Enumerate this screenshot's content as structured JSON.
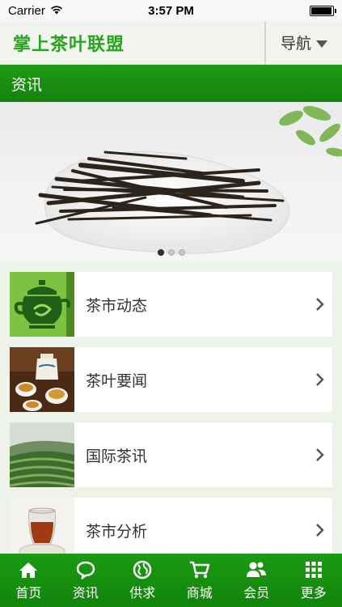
{
  "status_bar": {
    "carrier": "Carrier",
    "time": "3:57 PM",
    "battery_level": 0.95
  },
  "header": {
    "title": "掌上茶叶联盟",
    "nav_label": "导航"
  },
  "section": {
    "title": "资讯"
  },
  "banner": {
    "slide_count": 3,
    "active_slide": 1
  },
  "list": {
    "items": [
      {
        "label": "茶市动态",
        "icon": "teapot-icon"
      },
      {
        "label": "茶叶要闻",
        "icon": "tea-cups-icon"
      },
      {
        "label": "国际茶讯",
        "icon": "tea-plantation-icon"
      },
      {
        "label": "茶市分析",
        "icon": "tea-glass-icon"
      }
    ]
  },
  "tab_bar": {
    "tabs": [
      {
        "label": "首页",
        "icon": "home-icon"
      },
      {
        "label": "资讯",
        "icon": "chat-bubble-icon"
      },
      {
        "label": "供求",
        "icon": "globe-icon"
      },
      {
        "label": "商城",
        "icon": "cart-icon"
      },
      {
        "label": "会员",
        "icon": "members-icon"
      },
      {
        "label": "更多",
        "icon": "grid-icon"
      }
    ]
  },
  "colors": {
    "brand_green": "#1c9a14",
    "title_green": "#2aa31e"
  }
}
